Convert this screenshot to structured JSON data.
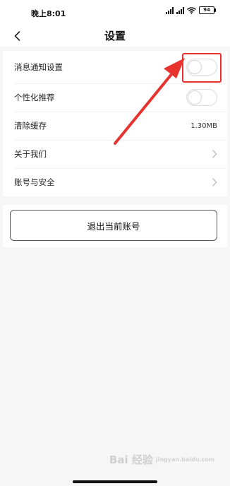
{
  "status_bar": {
    "time": "晚上8:01",
    "battery": "94"
  },
  "header": {
    "title": "设置"
  },
  "settings": [
    {
      "label": "消息通知设置",
      "control": "toggle",
      "on": false
    },
    {
      "label": "个性化推荐",
      "control": "toggle",
      "on": false
    },
    {
      "label": "清除缓存",
      "control": "value",
      "value": "1.30MB"
    },
    {
      "label": "关于我们",
      "control": "chevron"
    },
    {
      "label": "账号与安全",
      "control": "chevron"
    }
  ],
  "logout": {
    "label": "退出当前账号"
  },
  "watermark": {
    "brand": "Bai 经验",
    "url": "jingyan.baidu.com"
  },
  "colors": {
    "annotation": "#e8322e",
    "page_background": "#f6f6f6"
  }
}
